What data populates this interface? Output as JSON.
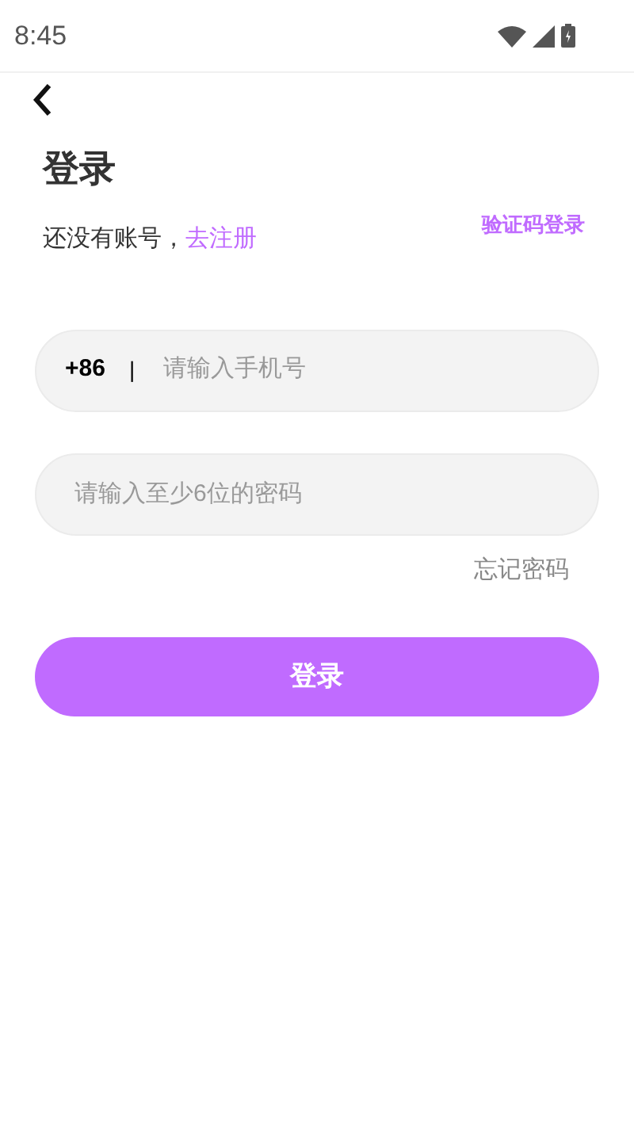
{
  "status_bar": {
    "time": "8:45"
  },
  "header": {
    "title": "登录",
    "register_prompt": "还没有账号，",
    "register_link": "去注册",
    "code_login_link": "验证码登录"
  },
  "phone_field": {
    "country_code": "+86",
    "separator": "|",
    "placeholder": "请输入手机号"
  },
  "password_field": {
    "placeholder": "请输入至少6位的密码"
  },
  "forgot_password_link": "忘记密码",
  "login_button": "登录"
}
